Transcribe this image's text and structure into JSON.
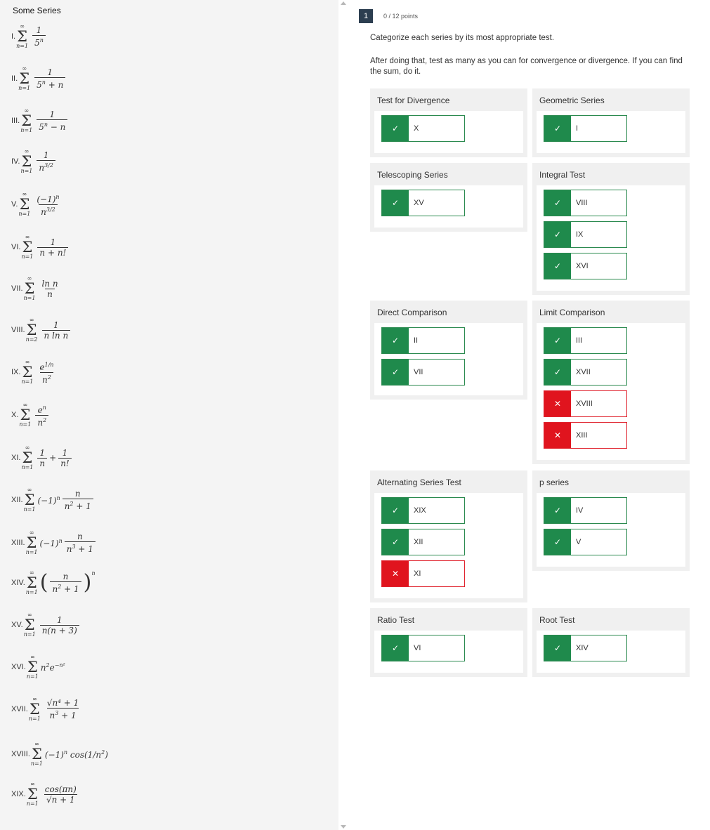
{
  "left_title": "Some Series",
  "series": [
    {
      "num": "I.",
      "top": "∞",
      "bot": "n=1"
    },
    {
      "num": "II.",
      "top": "∞",
      "bot": "n=1"
    },
    {
      "num": "III.",
      "top": "∞",
      "bot": "n=1"
    },
    {
      "num": "IV.",
      "top": "∞",
      "bot": "n=1"
    },
    {
      "num": "V.",
      "top": "∞",
      "bot": "n=1"
    },
    {
      "num": "VI.",
      "top": "∞",
      "bot": "n=1"
    },
    {
      "num": "VII.",
      "top": "∞",
      "bot": "n=1"
    },
    {
      "num": "VIII.",
      "top": "∞",
      "bot": "n=2"
    },
    {
      "num": "IX.",
      "top": "∞",
      "bot": "n=1"
    },
    {
      "num": "X.",
      "top": "∞",
      "bot": "n=1"
    },
    {
      "num": "XI.",
      "top": "∞",
      "bot": "n=1"
    },
    {
      "num": "XII.",
      "top": "∞",
      "bot": "n=1"
    },
    {
      "num": "XIII.",
      "top": "∞",
      "bot": "n=1"
    },
    {
      "num": "XIV.",
      "top": "∞",
      "bot": "n=1"
    },
    {
      "num": "XV.",
      "top": "∞",
      "bot": "n=1"
    },
    {
      "num": "XVI.",
      "top": "∞",
      "bot": "n=1"
    },
    {
      "num": "XVII.",
      "top": "∞",
      "bot": "n=1"
    },
    {
      "num": "XVIII.",
      "top": "∞",
      "bot": "n=1"
    },
    {
      "num": "XIX.",
      "top": "∞",
      "bot": "n=1"
    }
  ],
  "terms": {
    "one": "1",
    "s1_d": "5",
    "s1_e": "n",
    "s2_d": "5",
    "s2_e": "n",
    "s2_r": " + n",
    "s3_d": "5",
    "s3_e": "n",
    "s3_r": " − n",
    "s4_d": "n",
    "s4_e": "3/2",
    "s5_n": "(−1)",
    "s5_ne": "n",
    "s5_d": "n",
    "s5_e": "3/2",
    "s6_d": "n + n!",
    "s7_n": "ln n",
    "s7_d": "n",
    "s8_d": "n ln n",
    "s9_n": "e",
    "s9_ne": "1/n",
    "s9_d": "n",
    "s9_e": "2",
    "s10_n": "e",
    "s10_ne": "n",
    "s10_d": "n",
    "s10_e": "2",
    "s11_d1": "n",
    "s11_plus": "+",
    "s11_d2": "n!",
    "s12_pre": "(−1)",
    "s12_pe": "n",
    "s12_n": "n",
    "s12_d": "n",
    "s12_de": "2",
    "s12_dr": " + 1",
    "s13_pre": "(−1)",
    "s13_pe": "n",
    "s13_n": "n",
    "s13_d": "n",
    "s13_de": "3",
    "s13_dr": " + 1",
    "s14_lp": "(",
    "s14_n": "n",
    "s14_d": "n",
    "s14_de": "2",
    "s14_dr": " + 1",
    "s14_rp": ")",
    "s14_e": "n",
    "s15_d": "n(n + 3)",
    "s16_a": "n",
    "s16_ae": "2",
    "s16_b": "e",
    "s16_be": "−n²",
    "s17_n": "√n⁴ + 1",
    "s17_d": "n",
    "s17_de": "3",
    "s17_dr": " + 1",
    "s18_a": "(−1)",
    "s18_ae": "n",
    "s18_b": " cos(1/n",
    "s18_be": "2",
    "s18_c": ")",
    "s19_n": "cos(πn)",
    "s19_d": "√n + 1"
  },
  "question": {
    "number": "1",
    "points": "0 / 12 points"
  },
  "instructions": {
    "line1": "Categorize each series by its most appropriate test.",
    "line2": "After doing that, test as many as you can for convergence or divergence. If you can find the sum, do it."
  },
  "categories": {
    "divergence": {
      "label": "Test for Divergence",
      "items": [
        {
          "text": "X",
          "status": "correct"
        }
      ]
    },
    "geometric": {
      "label": "Geometric Series",
      "items": [
        {
          "text": "I",
          "status": "correct"
        }
      ]
    },
    "telescoping": {
      "label": "Telescoping Series",
      "items": [
        {
          "text": "XV",
          "status": "correct"
        }
      ]
    },
    "integral": {
      "label": "Integral Test",
      "items": [
        {
          "text": "VIII",
          "status": "correct"
        },
        {
          "text": "IX",
          "status": "correct"
        },
        {
          "text": "XVI",
          "status": "correct"
        }
      ]
    },
    "direct": {
      "label": "Direct Comparison",
      "items": [
        {
          "text": "II",
          "status": "correct"
        },
        {
          "text": "VII",
          "status": "correct"
        }
      ]
    },
    "limit": {
      "label": "Limit Comparison",
      "items": [
        {
          "text": "III",
          "status": "correct"
        },
        {
          "text": "XVII",
          "status": "correct"
        },
        {
          "text": "XVIII",
          "status": "incorrect"
        },
        {
          "text": "XIII",
          "status": "incorrect"
        }
      ]
    },
    "alternating": {
      "label": "Alternating Series Test",
      "items": [
        {
          "text": "XIX",
          "status": "correct"
        },
        {
          "text": "XII",
          "status": "correct"
        },
        {
          "text": "XI",
          "status": "incorrect"
        }
      ]
    },
    "pseries": {
      "label": "p series",
      "items": [
        {
          "text": "IV",
          "status": "correct"
        },
        {
          "text": "V",
          "status": "correct"
        }
      ]
    },
    "ratio": {
      "label": "Ratio Test",
      "items": [
        {
          "text": "VI",
          "status": "correct"
        }
      ]
    },
    "root": {
      "label": "Root Test",
      "items": [
        {
          "text": "XIV",
          "status": "correct"
        }
      ]
    }
  },
  "icons": {
    "correct": "✓",
    "incorrect": "✕"
  },
  "colors": {
    "correct": "#1f8a4c",
    "incorrect": "#e0141e",
    "header": "#2c3e50"
  }
}
